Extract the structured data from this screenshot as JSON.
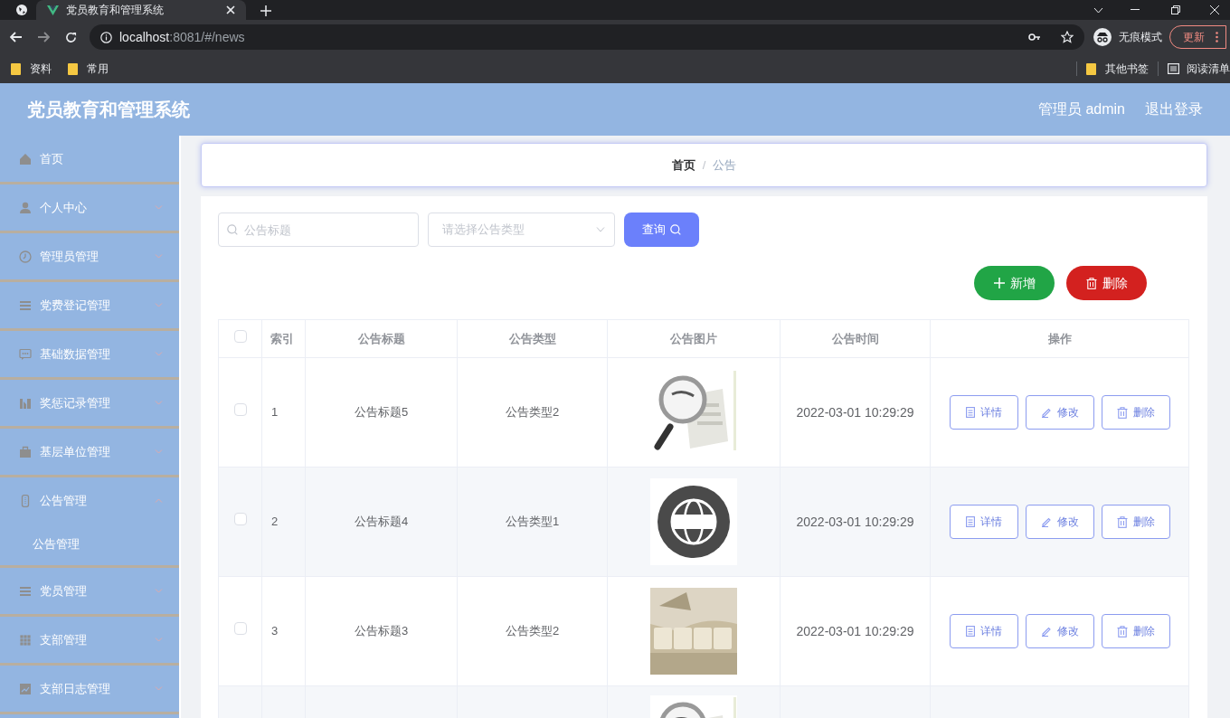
{
  "browser": {
    "tab_title": "党员教育和管理系统",
    "url_host": "localhost",
    "url_rest": ":8081/#/news",
    "incognito": "无痕模式",
    "update": "更新",
    "bookmarks": [
      "资料",
      "常用"
    ],
    "bookmarks_right": [
      "其他书签",
      "阅读清单"
    ]
  },
  "header": {
    "title": "党员教育和管理系统",
    "user": "管理员 admin",
    "logout": "退出登录"
  },
  "sidebar": {
    "items": [
      {
        "label": "首页"
      },
      {
        "label": "个人中心",
        "expanded": false
      },
      {
        "label": "管理员管理",
        "expanded": false
      },
      {
        "label": "党费登记管理",
        "expanded": false
      },
      {
        "label": "基础数据管理",
        "expanded": false
      },
      {
        "label": "奖惩记录管理",
        "expanded": false
      },
      {
        "label": "基层单位管理",
        "expanded": false
      },
      {
        "label": "公告管理",
        "expanded": true,
        "children": [
          {
            "label": "公告管理"
          }
        ]
      },
      {
        "label": "党员管理",
        "expanded": false
      },
      {
        "label": "支部管理",
        "expanded": false
      },
      {
        "label": "支部日志管理",
        "expanded": false
      }
    ]
  },
  "breadcrumb": [
    "首页",
    "公告"
  ],
  "breadcrumb_separator": "/",
  "search": {
    "title_placeholder": "公告标题",
    "type_placeholder": "请选择公告类型",
    "query_button": "查询"
  },
  "actions": {
    "add": "新增",
    "delete": "删除"
  },
  "table": {
    "header_checked": false,
    "columns": [
      "索引",
      "公告标题",
      "公告类型",
      "公告图片",
      "公告时间",
      "操作"
    ],
    "rows": [
      {
        "checked": false,
        "index": "1",
        "title": "公告标题5",
        "type": "公告类型2",
        "image": {
          "kind": "picture"
        },
        "time": "2022-03-01 10:29:29",
        "buttons": [
          "详情",
          "修改",
          "删除"
        ]
      },
      {
        "checked": false,
        "index": "2",
        "title": "公告标题4",
        "type": "公告类型1",
        "image": {
          "kind": "picture"
        },
        "time": "2022-03-01 10:29:29",
        "buttons": [
          "详情",
          "修改",
          "删除"
        ]
      },
      {
        "checked": false,
        "index": "3",
        "title": "公告标题3",
        "type": "公告类型2",
        "image": {
          "kind": "picture"
        },
        "time": "2022-03-01 10:29:29",
        "buttons": [
          "详情",
          "修改",
          "删除"
        ]
      },
      {
        "image": {
          "kind": "picture"
        }
      }
    ]
  }
}
